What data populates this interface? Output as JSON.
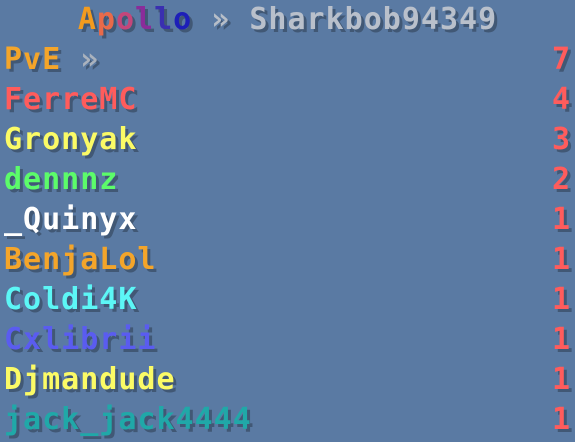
{
  "title": {
    "server": "Apollo",
    "arrow": "»",
    "player": "Sharkbob94349",
    "server_gradient": [
      "#f29b1e",
      "#e86a4a",
      "#c4467a",
      "#8a2c9a",
      "#3a2fb0",
      "#1d1fb8"
    ],
    "player_color": "#b9c0cb"
  },
  "category": {
    "label": "PvE",
    "arrow": "»",
    "value": "7",
    "label_color": "#f4a52a",
    "value_color": "#ff5c5c"
  },
  "players": [
    {
      "name": "FerreMC",
      "score": "4",
      "color": "#ff5c5c"
    },
    {
      "name": "Gronyak",
      "score": "3",
      "color": "#fbfb66"
    },
    {
      "name": "dennnz",
      "score": "2",
      "color": "#5cfc6a"
    },
    {
      "name": "_Quinyx",
      "score": "1",
      "color": "#ffffff"
    },
    {
      "name": "BenjaLol",
      "score": "1",
      "color": "#f4a52a"
    },
    {
      "name": "Coldi4K",
      "score": "1",
      "color": "#5cf6f6"
    },
    {
      "name": "Cxlibrii",
      "score": "1",
      "color": "#5a5cf0"
    },
    {
      "name": "Djmandude",
      "score": "1",
      "color": "#fbfb66"
    },
    {
      "name": "jack_jack4444",
      "score": "1",
      "color": "#20a8a8"
    }
  ],
  "score_color": "#ff5c5c"
}
